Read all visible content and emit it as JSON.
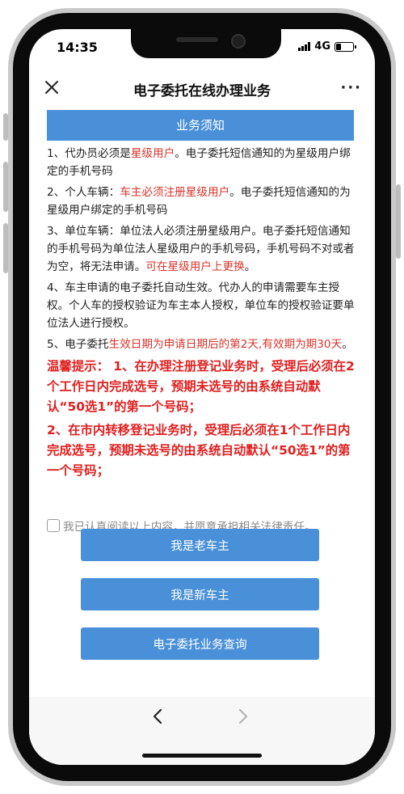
{
  "status_bar": {
    "time": "14:35",
    "network": "4G"
  },
  "nav": {
    "title": "电子委托在线办理业务",
    "more": "···"
  },
  "notice": {
    "header": "业务须知",
    "items": [
      {
        "a": "1、代办员必须是",
        "b": "星级用户",
        "c": "。电子委托短信通知的为星级用户绑定的手机号码"
      },
      {
        "a": "2、个人车辆：",
        "b": "车主必须注册星级用户",
        "c": "。电子委托短信通知的为星级用户绑定的手机号码"
      },
      {
        "a": "3、单位车辆：单位法人必须注册星级用户。电子委托短信通知的手机号码为单位法人星级用户的手机号码，手机号码不对或者为空，将无法申请。",
        "b": "可在星级用户上更换",
        "c": "。"
      },
      {
        "a": "4、车主申请的电子委托自动生效。代办人的申请需要车主授权。个人车的授权验证为车主本人授权，单位车的授权验证要单位法人进行授权。",
        "b": "",
        "c": ""
      },
      {
        "a": "5、电子委托",
        "b": "生效日期为申请日期后的第2天,有效期为期30天",
        "c": "。"
      }
    ],
    "warning_1": "温馨提示： 1、在办理注册登记业务时，受理后必须在2个工作日内完成选号，预期未选号的由系统自动默认“50选1”的第一个号码；",
    "warning_2": "2、在市内转移登记业务时，受理后必须在1个工作日内完成选号，预期未选号的由系统自动默认“50选1”的第一个号码；"
  },
  "agreement": {
    "label": "我已认真阅读以上内容，并愿意承担相关法律责任。",
    "checked": false
  },
  "buttons": {
    "old_owner": "我是老车主",
    "new_owner": "我是新车主",
    "query": "电子委托业务查询"
  },
  "colors": {
    "accent": "#4a90d9",
    "highlight": "#d9342b",
    "warning": "#e02020"
  }
}
